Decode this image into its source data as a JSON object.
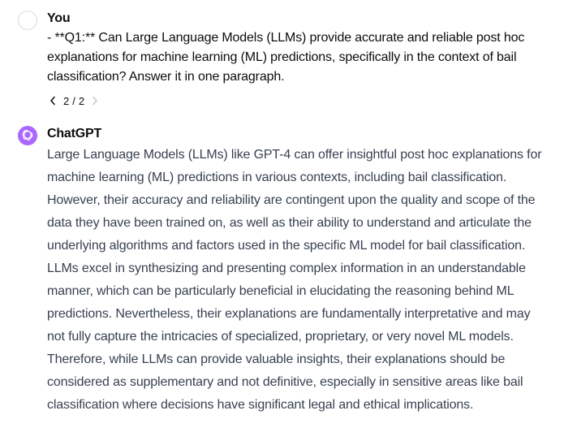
{
  "conversation": {
    "user": {
      "author": "You",
      "message": "- **Q1:** Can Large Language Models (LLMs) provide accurate and reliable post hoc explanations for machine learning (ML) predictions, specifically in the context of bail classification? Answer it in one paragraph.",
      "pager": "2 / 2",
      "icons": [
        "chevron-left-icon",
        "chevron-right-icon"
      ]
    },
    "assistant": {
      "author": "ChatGPT",
      "avatar_icon": "openai-logo-icon",
      "avatar_color": "#ab68ff",
      "message": "Large Language Models (LLMs) like GPT-4 can offer insightful post hoc explanations for machine learning (ML) predictions in various contexts, including bail classification. However, their accuracy and reliability are contingent upon the quality and scope of the data they have been trained on, as well as their ability to understand and articulate the underlying algorithms and factors used in the specific ML model for bail classification. LLMs excel in synthesizing and presenting complex information in an understandable manner, which can be particularly beneficial in elucidating the reasoning behind ML predictions. Nevertheless, their explanations are fundamentally interpretative and may not fully capture the intricacies of specialized, proprietary, or very novel ML models. Therefore, while LLMs can provide valuable insights, their explanations should be considered as supplementary and not definitive, especially in sensitive areas like bail classification where decisions have significant legal and ethical implications."
    }
  }
}
